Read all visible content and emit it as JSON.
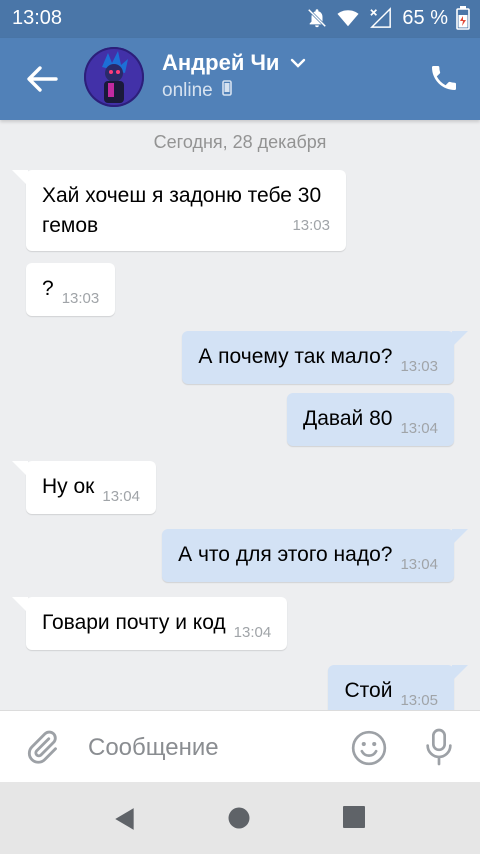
{
  "status_bar": {
    "time": "13:08",
    "battery_percent": "65 %",
    "icons": [
      "muted-bell-icon",
      "wifi-icon",
      "no-signal-icon",
      "battery-icon"
    ]
  },
  "header": {
    "back_icon": "arrow-left-icon",
    "contact_name": "Андрей Чи",
    "status": "online",
    "status_icon": "phone-device-icon",
    "call_icon": "phone-icon"
  },
  "chat": {
    "date_separator": "Сегодня, 28 декабря",
    "messages": [
      {
        "dir": "in",
        "text": "Хай хочеш я задоню тебе 30 гемов",
        "time": "13:03"
      },
      {
        "dir": "in",
        "text": "?",
        "time": "13:03"
      },
      {
        "dir": "out",
        "text": "А почему так мало?",
        "time": "13:03"
      },
      {
        "dir": "out",
        "text": "Давай 80",
        "time": "13:04"
      },
      {
        "dir": "in",
        "text": "Ну ок",
        "time": "13:04"
      },
      {
        "dir": "out",
        "text": "А что для этого надо?",
        "time": "13:04"
      },
      {
        "dir": "in",
        "text": "Говари почту и код",
        "time": "13:04"
      },
      {
        "dir": "out",
        "text": "Стой",
        "time": "13:05"
      }
    ]
  },
  "composer": {
    "placeholder": "Сообщение",
    "attach_icon": "paperclip-icon",
    "emoji_icon": "smiley-icon",
    "mic_icon": "microphone-icon"
  },
  "colors": {
    "header": "#5181b8",
    "status_bar": "#4a76a8",
    "incoming_bubble": "#ffffff",
    "outgoing_bubble": "#d3e2f5",
    "chat_background": "#edeef0"
  }
}
